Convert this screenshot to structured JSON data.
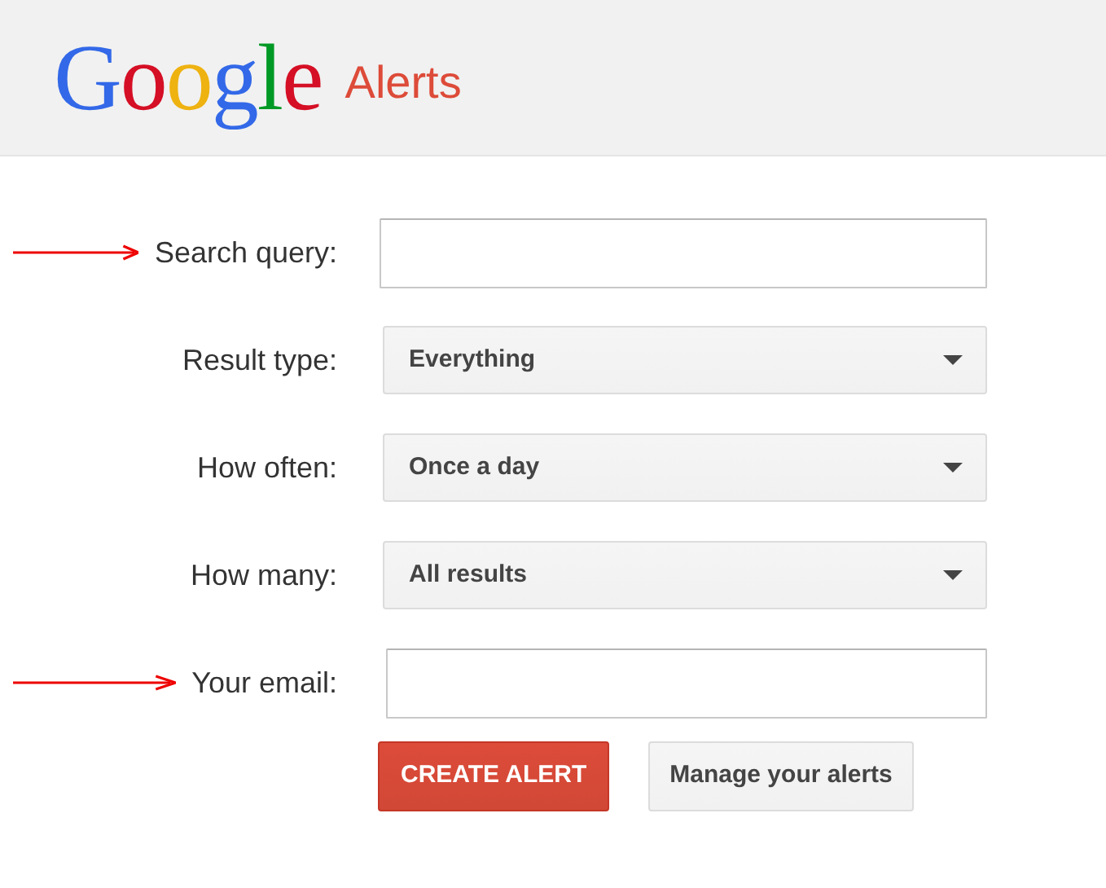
{
  "header": {
    "logo_letters": [
      {
        "char": "G",
        "color": "#3369e8"
      },
      {
        "char": "o",
        "color": "#d50f25"
      },
      {
        "char": "o",
        "color": "#eeb211"
      },
      {
        "char": "g",
        "color": "#3369e8"
      },
      {
        "char": "l",
        "color": "#009925"
      },
      {
        "char": "e",
        "color": "#d50f25"
      }
    ],
    "product": "Alerts"
  },
  "fields": [
    {
      "kind": "text",
      "label": "Search query:",
      "annotated": true
    },
    {
      "kind": "select",
      "label": "Result type:",
      "value": "Everything",
      "annotated": false
    },
    {
      "kind": "select",
      "label": "How often:",
      "value": "Once a day",
      "annotated": false
    },
    {
      "kind": "select",
      "label": "How many:",
      "value": "All results",
      "annotated": false
    },
    {
      "kind": "text",
      "label": "Your email:",
      "annotated": true
    }
  ],
  "buttons": [
    {
      "kind": "primary",
      "label": "CREATE ALERT"
    },
    {
      "kind": "secondary",
      "label": "Manage your alerts"
    }
  ]
}
